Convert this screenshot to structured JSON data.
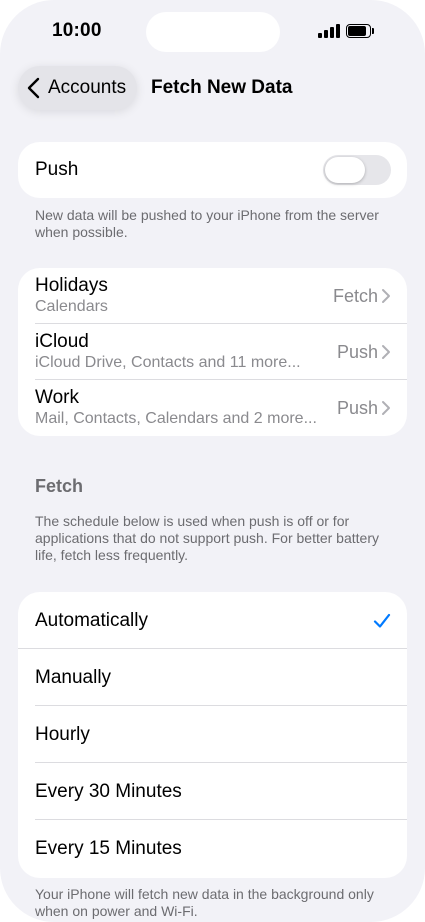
{
  "status_bar": {
    "time": "10:00"
  },
  "nav": {
    "back_label": "Accounts",
    "title": "Fetch New Data"
  },
  "push": {
    "label": "Push",
    "enabled": false,
    "footnote": "New data will be pushed to your iPhone from the server when possible."
  },
  "accounts": [
    {
      "name": "Holidays",
      "subtitle": "Calendars",
      "value": "Fetch"
    },
    {
      "name": "iCloud",
      "subtitle": "iCloud Drive, Contacts and 11 more...",
      "value": "Push"
    },
    {
      "name": "Work",
      "subtitle": "Mail, Contacts, Calendars and 2 more...",
      "value": "Push"
    }
  ],
  "fetch_section": {
    "header": "Fetch",
    "description": "The schedule below is used when push is off or for applications that do not support push. For better battery life, fetch less frequently.",
    "options": [
      "Automatically",
      "Manually",
      "Hourly",
      "Every 30 Minutes",
      "Every 15 Minutes"
    ],
    "selected": "Automatically",
    "footnote": "Your iPhone will fetch new data in the background only when on power and Wi-Fi."
  },
  "colors": {
    "accent": "#007aff",
    "background": "#f2f2f7",
    "secondary_text": "#8a8a8e"
  }
}
